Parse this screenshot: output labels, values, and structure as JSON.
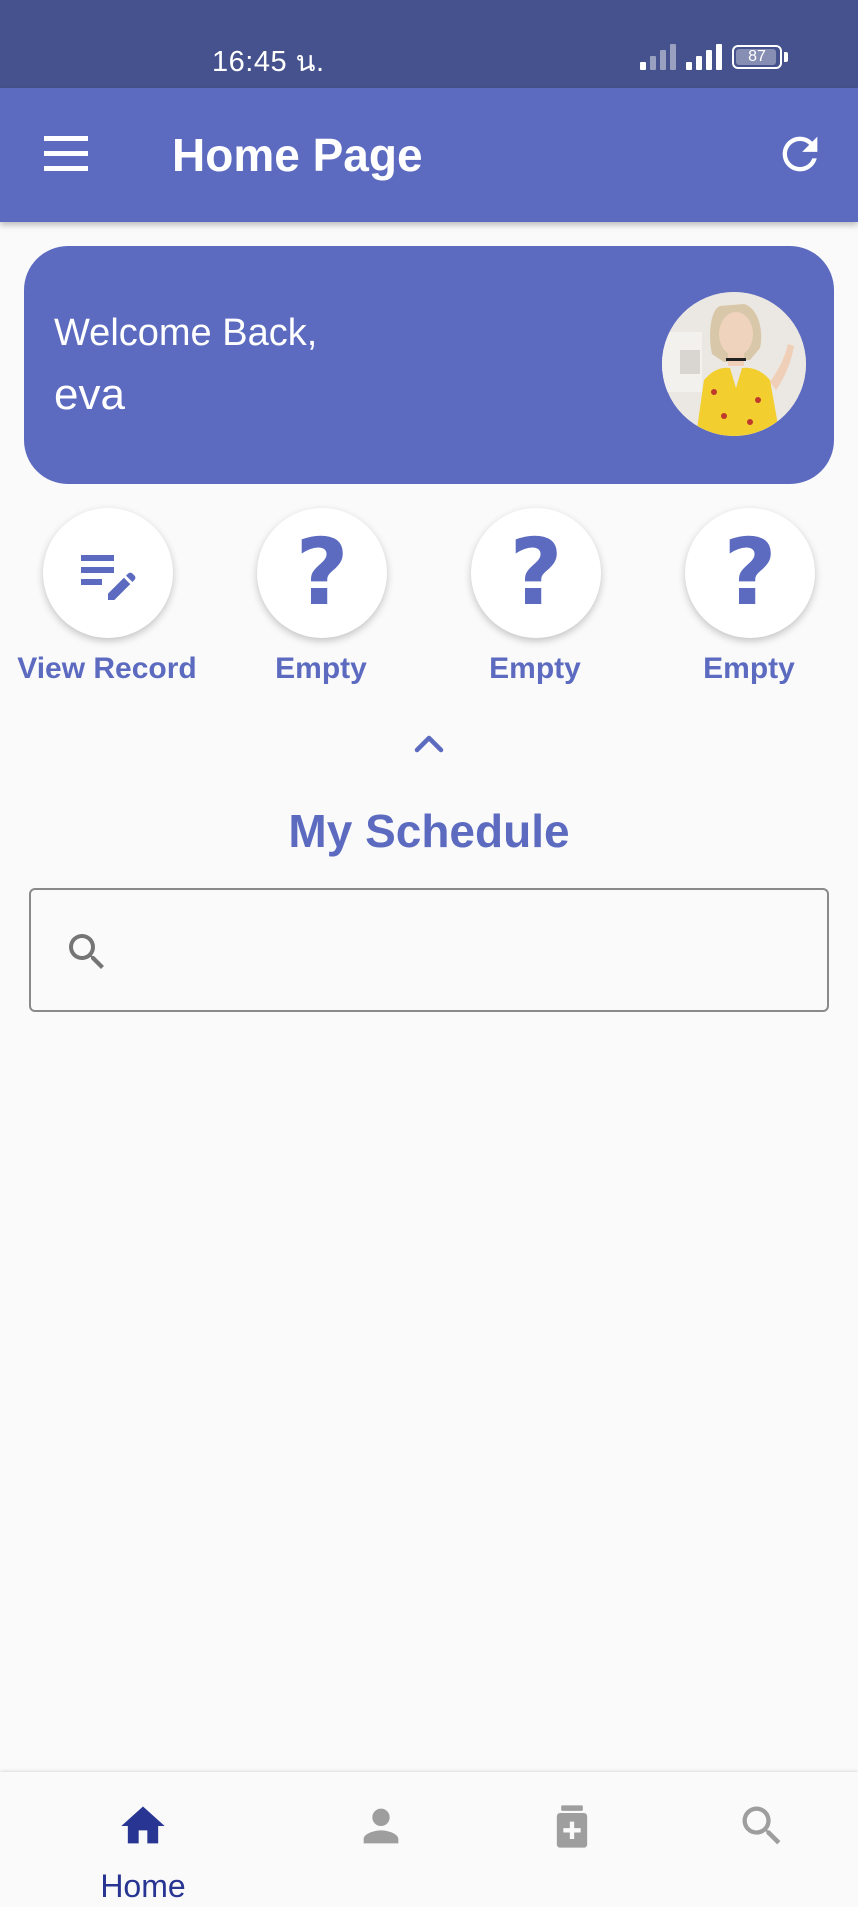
{
  "status_bar": {
    "time": "16:45 น.",
    "battery": "87"
  },
  "app_bar": {
    "title": "Home Page"
  },
  "welcome": {
    "greeting": "Welcome Back,",
    "username": "eva"
  },
  "shortcuts": [
    {
      "label": "View Record",
      "icon": "edit-note-icon"
    },
    {
      "label": "Empty",
      "icon": "question-icon"
    },
    {
      "label": "Empty",
      "icon": "question-icon"
    },
    {
      "label": "Empty",
      "icon": "question-icon"
    }
  ],
  "schedule": {
    "title": "My Schedule",
    "search_value": "",
    "search_placeholder": ""
  },
  "bottom_nav": {
    "items": [
      {
        "label": "Home",
        "icon": "home-icon",
        "active": true
      },
      {
        "label": "",
        "icon": "person-icon",
        "active": false
      },
      {
        "label": "",
        "icon": "medical-box-icon",
        "active": false
      },
      {
        "label": "",
        "icon": "search-icon",
        "active": false
      }
    ]
  },
  "colors": {
    "primary": "#5c6bc0",
    "status_bar": "#46528d",
    "nav_active": "#283593",
    "nav_inactive": "#9e9e9e",
    "background": "#fafafa"
  }
}
